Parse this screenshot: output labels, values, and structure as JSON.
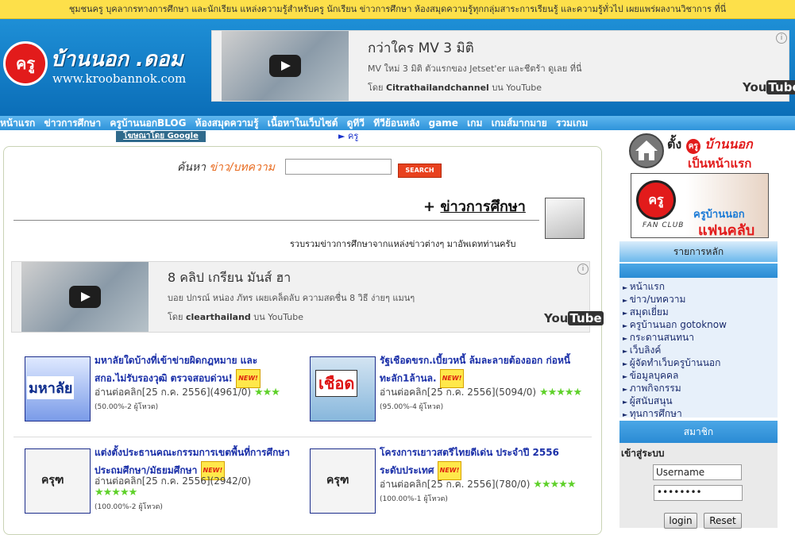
{
  "topbar": {
    "text": "ชุมชนครู บุคลากรทางการศึกษา และนักเรียน แหล่งความรู้สำหรับครู นักเรียน ข่าวการศึกษา ห้องสมุดความรู้ทุกกลุ่มสาระการเรียนรู้ และความรู้ทั่วไป เผยแพร่ผลงานวิชาการ ที่นี่"
  },
  "logo": {
    "badge": "ครู",
    "name": "บ้านนอก .ดอม",
    "url": "www.kroobannok.com"
  },
  "yt_top": {
    "title": "กว่าใคร MV 3 มิติ",
    "desc": "MV ใหม่ 3 มิติ ตัวแรกของ Jetset'er และชีตร้า ดูเลย ที่นี่",
    "by_prefix": "โดย",
    "channel": "Citrathailandchannel",
    "by_suffix": "บน YouTube",
    "logo_you": "You",
    "logo_tube": "Tube",
    "info": "i"
  },
  "nav": {
    "items": [
      "หน้าแรก",
      "ข่าวการศึกษา",
      "ครูบ้านนอกBLOG",
      "ห้องสมุดความรู้",
      "เนื้อหาในเว็บไซต์",
      "ดูทีวี",
      "ทีวีย้อนหลัง",
      "game",
      "เกม",
      "เกมส์มากมาย",
      "รวมเกม"
    ]
  },
  "google_tag": "โฆษณาโดย Google",
  "kru_link": "► ครู",
  "search": {
    "label": "ค้นหา",
    "label_em": "ข่าว/บทความ",
    "value": "",
    "button": "SEARCH"
  },
  "section": {
    "plus": "+",
    "title": "ข่าวการศึกษา",
    "desc": "รวบรวมข่าวการศึกษาจากแหล่งข่าวต่างๆ มาอัพเดทท่านครับ"
  },
  "yt_mid": {
    "title": "8 คลิป เกรียน มันส์ ฮา",
    "desc": "บอย ปกรณ์ หน่อง ภัทร เผยเคล็ดลับ ความสดชื่น 8 วิธี ง่ายๆ แมนๆ",
    "by_prefix": "โดย",
    "channel": "clearthailand",
    "by_suffix": "บน YouTube",
    "logo_you": "You",
    "logo_tube": "Tube",
    "info": "i"
  },
  "news": [
    {
      "title": "มหาลัยใดบ้างที่เข้าข่ายผิดกฎหมาย และ สกอ.ไม่รับรองวุฒิ ตรวจสอบด่วน!",
      "badge": "NEW!",
      "meta": "อ่านต่อคลิก[25 ก.ค. 2556](4961/0)",
      "stars": "★★★",
      "votes": "(50.00%-2 ผู้โหวต)",
      "thumb": "มหาลัย"
    },
    {
      "title": "รัฐเชือดขรก.เบี้ยวหนี้ ล้มละลายต้องออก ก่อหนี้ทะลัก1ล้านล.",
      "badge": "NEW!",
      "meta": "อ่านต่อคลิก[25 ก.ค. 2556](5094/0)",
      "stars": "★★★★★",
      "votes": "(95.00%-4 ผู้โหวต)",
      "thumb": "เชือด"
    },
    {
      "title": "แต่งตั้งประธานคณะกรรมการเขตพื้นที่การศึกษาประถมศึกษา/มัธยมศึกษา",
      "badge": "NEW!",
      "meta": "อ่านต่อคลิก[25 ก.ค. 2556](2942/0)",
      "stars": "★★★★★",
      "votes": "(100.00%-2 ผู้โหวต)",
      "thumb": "ครุฑ"
    },
    {
      "title": "โครงการเยาวสตรีไทยดีเด่น ประจำปี 2556 ระดับประเทศ",
      "badge": "NEW!",
      "meta": "อ่านต่อคลิก[25 ก.ค. 2556](780/0)",
      "stars": "★★★★★",
      "votes": "(100.00%-1 ผู้โหวต)",
      "thumb": "ครุฑ"
    }
  ],
  "side": {
    "home_pre": "ตั้ง",
    "home_badge": "ครู",
    "home_name": "บ้านนอก",
    "home_post": "เป็นหน้าแรก",
    "fan_badge": "ครู",
    "fan_club": "FAN CLUB",
    "fan_name": "ครูบ้านนอก",
    "fan_name2": "แฟนคลับ",
    "menu_head": "รายการหลัก",
    "menu": [
      "หน้าแรก",
      "ข่าว/บทความ",
      "สมุดเยี่ยม",
      "ครูบ้านนอก gotoknow",
      "กระดานสนทนา",
      "เว็บลิงค์",
      "ผู้จัดทำเว็บครูบ้านนอก",
      "ข้อมูลบุคคล",
      "ภาพกิจกรรม",
      "ผู้สนับสนุน",
      "ทุนการศึกษา"
    ],
    "member_head": "สมาชิก",
    "login_label": "เข้าสู่ระบบ",
    "username": "Username",
    "password": "••••••••",
    "login_btn": "login",
    "reset_btn": "Reset"
  }
}
